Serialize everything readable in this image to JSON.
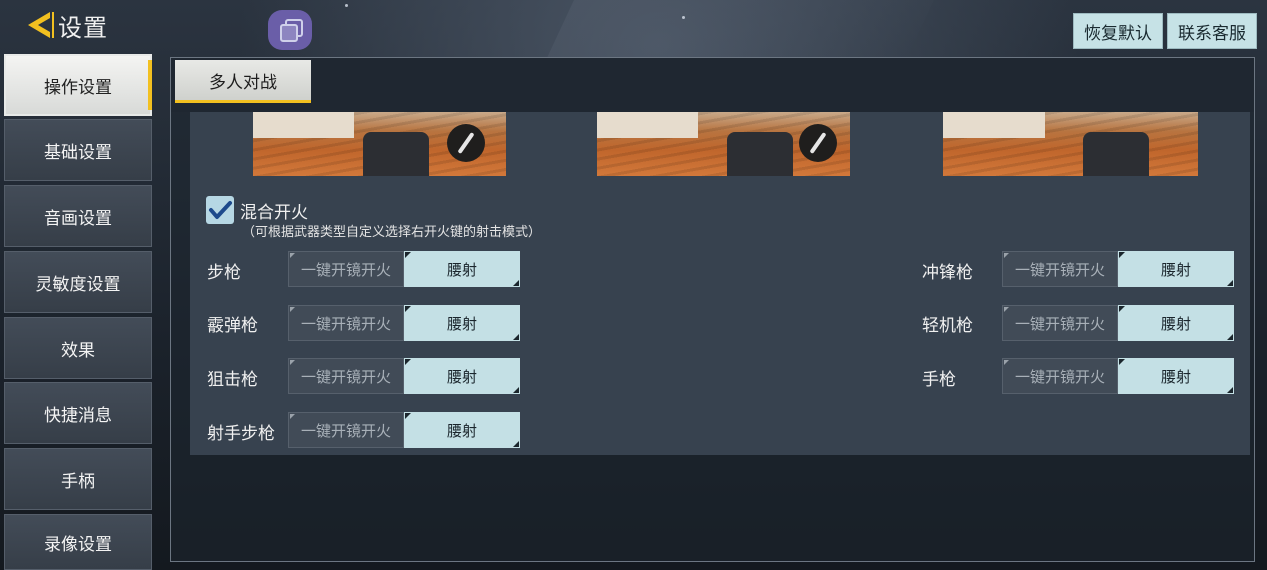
{
  "header": {
    "title": "设置",
    "back_icon": "back-arrow-icon",
    "app_icon": "overlay-squares-icon",
    "buttons": {
      "reset": "恢复默认",
      "support": "联系客服"
    }
  },
  "sidebar": {
    "items": [
      {
        "label": "操作设置",
        "active": true
      },
      {
        "label": "基础设置",
        "active": false
      },
      {
        "label": "音画设置",
        "active": false
      },
      {
        "label": "灵敏度设置",
        "active": false
      },
      {
        "label": "效果",
        "active": false
      },
      {
        "label": "快捷消息",
        "active": false
      },
      {
        "label": "手柄",
        "active": false
      },
      {
        "label": "录像设置",
        "active": false
      }
    ]
  },
  "tabs": [
    {
      "label": "多人对战",
      "active": true
    }
  ],
  "mixed_fire": {
    "checked": true,
    "label": "混合开火",
    "description": "（可根据武器类型自定义选择右开火键的射击模式）"
  },
  "weapons": {
    "option_off": "一键开镜开火",
    "option_on": "腰射",
    "left": [
      {
        "name": "步枪",
        "selected": "腰射"
      },
      {
        "name": "霰弹枪",
        "selected": "腰射"
      },
      {
        "name": "狙击枪",
        "selected": "腰射"
      },
      {
        "name": "射手步枪",
        "selected": "腰射"
      }
    ],
    "right": [
      {
        "name": "冲锋枪",
        "selected": "腰射"
      },
      {
        "name": "轻机枪",
        "selected": "腰射"
      },
      {
        "name": "手枪",
        "selected": "腰射"
      }
    ]
  },
  "colors": {
    "accent": "#f2c020",
    "button_bg": "#c6e2e6",
    "selected_bg": "#c4e0e5",
    "content_bg": "#37424f"
  }
}
